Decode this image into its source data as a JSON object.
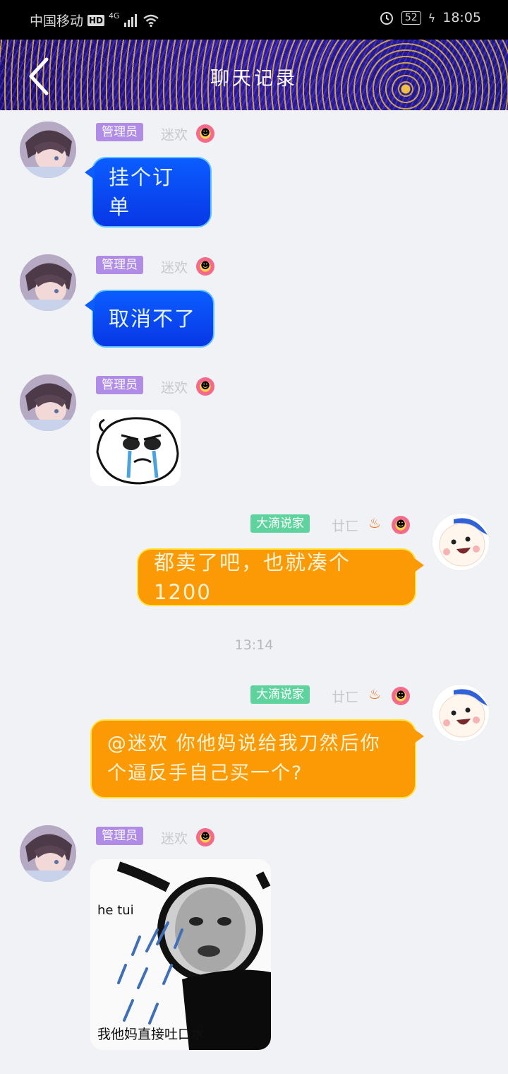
{
  "status_bar": {
    "carrier": "中国移动",
    "hd": "HD",
    "network": "4G",
    "battery": "52",
    "time": "18:05"
  },
  "header": {
    "title": "聊天记录"
  },
  "messages": [
    {
      "side": "left",
      "tag": "管理员",
      "nickname": "迷欢",
      "text": "挂个订单"
    },
    {
      "side": "left",
      "tag": "管理员",
      "nickname": "迷欢",
      "text": "取消不了"
    },
    {
      "side": "left",
      "tag": "管理员",
      "nickname": "迷欢",
      "sticker": "crying-cartoon-sticker"
    },
    {
      "side": "right",
      "tag": "大滴说家",
      "nickname": "廿匸",
      "text": "都卖了吧，也就凑个1200"
    },
    {
      "side": "right",
      "tag": "大滴说家",
      "nickname": "廿匸",
      "text": "@迷欢 你他妈说给我刀然后你个逼反手自己买一个?"
    },
    {
      "side": "left",
      "tag": "管理员",
      "nickname": "迷欢",
      "sticker": "spitting-meme-sticker",
      "sticker_caption": "我他妈直接吐口水",
      "sticker_text": "he  tui"
    }
  ],
  "timestamp": "13:14",
  "colors": {
    "blue_bubble": "#0b5dff",
    "orange_bubble": "#fb9a05",
    "tag_purple": "#b08ce6",
    "tag_green": "#5fd39e"
  }
}
